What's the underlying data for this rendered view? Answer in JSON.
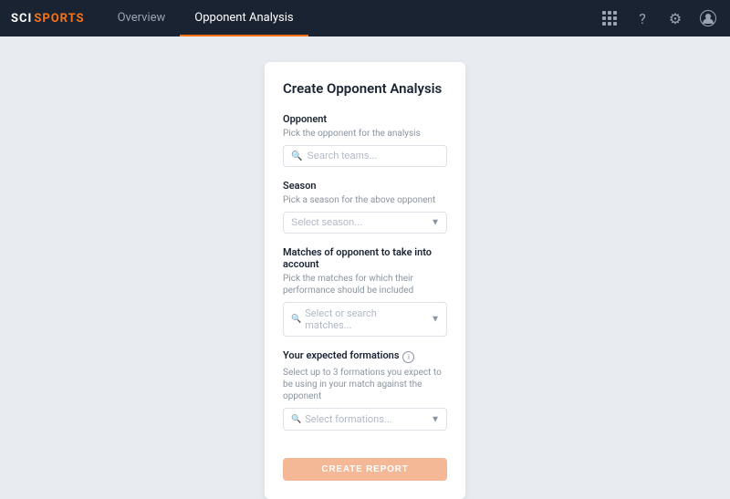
{
  "app": {
    "logo_sci": "SCI",
    "logo_sports": "SPORTS"
  },
  "nav": {
    "items": [
      {
        "label": "Overview",
        "active": false
      },
      {
        "label": "Opponent Analysis",
        "active": true
      }
    ]
  },
  "card": {
    "title": "Create Opponent Analysis",
    "opponent": {
      "label": "Opponent",
      "hint": "Pick the opponent for the analysis",
      "placeholder": "Search teams..."
    },
    "season": {
      "label": "Season",
      "hint": "Pick a season for the above opponent",
      "placeholder": "Select season..."
    },
    "matches": {
      "label": "Matches of opponent to take into account",
      "hint": "Pick the matches for which their performance should be included",
      "placeholder": "Select or search matches..."
    },
    "formations": {
      "label": "Your expected formations",
      "hint": "Select up to 3 formations you expect to be using in your match against the opponent",
      "placeholder": "Select formations..."
    },
    "create_button": "CREATE REPORT"
  }
}
